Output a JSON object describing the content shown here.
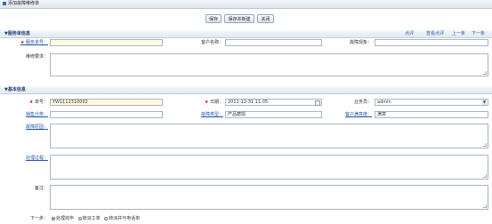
{
  "window": {
    "title": "添加故障维修单"
  },
  "toolbar": {
    "save": "保存",
    "save_new": "保存并新建",
    "close": "关闭"
  },
  "service_section": {
    "title": "▼服务单信息",
    "nav": {
      "start": "点评",
      "view": "查看点评",
      "prev": "上一条",
      "next": "下一条"
    },
    "service_no_label": "服务单号：",
    "service_no_value": "",
    "customer_label": "客户名称：",
    "customer_value": "",
    "fault_label": "故障现象：",
    "fault_value": "",
    "repair_req_label": "维修要求："
  },
  "basic_section": {
    "title": "▼基本信息",
    "order_no_label": "单号：",
    "order_no_value": "YW1112310002",
    "date_label": "日期：",
    "date_value": "2011-12-31 11:05",
    "staff_label": "业务员：",
    "staff_value": "admin",
    "sales_label": "销售分类：",
    "sales_value": "",
    "fault_type_label": "故障类型：",
    "fault_type_value": "产品磨损",
    "satisfaction_label": "客户满意度：",
    "satisfaction_value": "满意",
    "cause_label": "故障原因：",
    "process_label": "处理过程：",
    "remark_label": "备注：",
    "next_step_label": "下一步：",
    "next_options": [
      "处理完毕",
      "转派工单",
      "转派并与电话单"
    ]
  }
}
